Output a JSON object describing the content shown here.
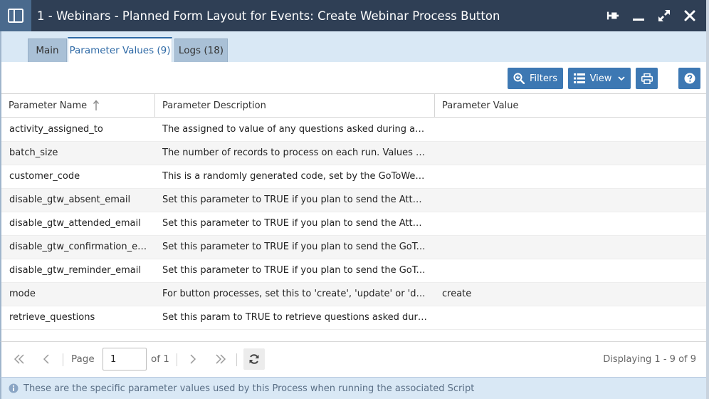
{
  "window": {
    "title": "1 - Webinars - Planned Form Layout for Events: Create Webinar Process Button"
  },
  "tabs": [
    {
      "label": "Main",
      "active": false
    },
    {
      "label": "Parameter Values (9)",
      "active": true
    },
    {
      "label": "Logs (18)",
      "active": false
    }
  ],
  "toolbar": {
    "filters_label": "Filters",
    "view_label": "View"
  },
  "grid": {
    "columns": [
      "Parameter Name",
      "Parameter Description",
      "Parameter Value"
    ],
    "rows": [
      {
        "name": "activity_assigned_to",
        "description": "The assigned to value of any questions asked during a webi...",
        "value": ""
      },
      {
        "name": "batch_size",
        "description": "The number of records to process on each run. Values are ...",
        "value": ""
      },
      {
        "name": "customer_code",
        "description": "This is a randomly generated code, set by the GoToWebinar...",
        "value": ""
      },
      {
        "name": "disable_gtw_absent_email",
        "description": "Set this parameter to TRUE if you plan to send the Attendee...",
        "value": ""
      },
      {
        "name": "disable_gtw_attended_email",
        "description": "Set this parameter to TRUE if you plan to send the Attendee...",
        "value": ""
      },
      {
        "name": "disable_gtw_confirmation_email",
        "description": "Set this parameter to TRUE if you plan to send the GoToWe...",
        "value": ""
      },
      {
        "name": "disable_gtw_reminder_email",
        "description": "Set this parameter to TRUE if you plan to send the GoToWe...",
        "value": ""
      },
      {
        "name": "mode",
        "description": "For button processes, set this to 'create', 'update' or 'delete'...",
        "value": "create"
      },
      {
        "name": "retrieve_questions",
        "description": "Set this param to TRUE to retrieve questions asked during t...",
        "value": ""
      }
    ]
  },
  "pager": {
    "page_label": "Page",
    "page_value": "1",
    "of_label": "of 1",
    "display_info": "Displaying 1 - 9 of 9"
  },
  "status": {
    "message": "These are the specific parameter values used by this Process when running the associated Script"
  },
  "colors": {
    "titlebar": "#2f3f55",
    "accent": "#3d78b3",
    "tabbar": "#d9e8f5"
  }
}
